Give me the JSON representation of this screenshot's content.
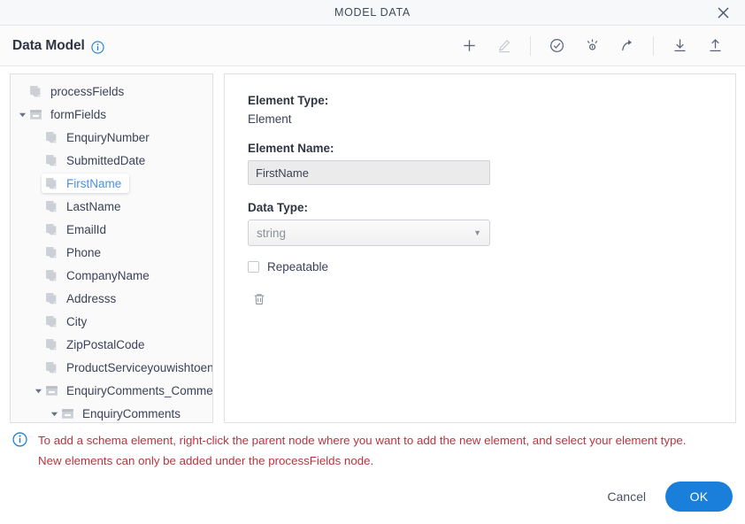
{
  "window": {
    "title": "MODEL DATA",
    "close_icon": "close-icon"
  },
  "toolbar": {
    "panel_title": "Data Model",
    "info_icon": "info-circle-icon",
    "buttons": [
      {
        "name": "add-element-button",
        "icon": "plus-icon",
        "enabled": true
      },
      {
        "name": "edit-element-button",
        "icon": "pencil-icon",
        "enabled": false
      },
      {
        "name": "validate-button",
        "icon": "check-circle-icon",
        "enabled": true
      },
      {
        "name": "generate-sample-button",
        "icon": "sparkle-icon",
        "enabled": true
      },
      {
        "name": "share-button",
        "icon": "arrow-curve-right-icon",
        "enabled": true
      },
      {
        "name": "import-button",
        "icon": "download-icon",
        "enabled": true
      },
      {
        "name": "export-button",
        "icon": "upload-icon",
        "enabled": true
      }
    ]
  },
  "tree": {
    "nodes": [
      {
        "label": "processFields",
        "depth": 0,
        "type": "leaf",
        "expandable": false,
        "expanded": false,
        "selected": false
      },
      {
        "label": "formFields",
        "depth": 0,
        "type": "folder",
        "expandable": true,
        "expanded": true,
        "selected": false
      },
      {
        "label": "EnquiryNumber",
        "depth": 1,
        "type": "leaf",
        "expandable": false,
        "expanded": false,
        "selected": false
      },
      {
        "label": "SubmittedDate",
        "depth": 1,
        "type": "leaf",
        "expandable": false,
        "expanded": false,
        "selected": false
      },
      {
        "label": "FirstName",
        "depth": 1,
        "type": "leaf",
        "expandable": false,
        "expanded": false,
        "selected": true
      },
      {
        "label": "LastName",
        "depth": 1,
        "type": "leaf",
        "expandable": false,
        "expanded": false,
        "selected": false
      },
      {
        "label": "EmailId",
        "depth": 1,
        "type": "leaf",
        "expandable": false,
        "expanded": false,
        "selected": false
      },
      {
        "label": "Phone",
        "depth": 1,
        "type": "leaf",
        "expandable": false,
        "expanded": false,
        "selected": false
      },
      {
        "label": "CompanyName",
        "depth": 1,
        "type": "leaf",
        "expandable": false,
        "expanded": false,
        "selected": false
      },
      {
        "label": "Addresss",
        "depth": 1,
        "type": "leaf",
        "expandable": false,
        "expanded": false,
        "selected": false
      },
      {
        "label": "City",
        "depth": 1,
        "type": "leaf",
        "expandable": false,
        "expanded": false,
        "selected": false
      },
      {
        "label": "ZipPostalCode",
        "depth": 1,
        "type": "leaf",
        "expandable": false,
        "expanded": false,
        "selected": false
      },
      {
        "label": "ProductServiceyouwishtoenquireabout",
        "depth": 1,
        "type": "leaf",
        "expandable": false,
        "expanded": false,
        "selected": false
      },
      {
        "label": "EnquiryComments_CommentsSection",
        "depth": 1,
        "type": "folder",
        "expandable": true,
        "expanded": true,
        "selected": false
      },
      {
        "label": "EnquiryComments",
        "depth": 2,
        "type": "folder",
        "expandable": true,
        "expanded": true,
        "selected": false
      }
    ]
  },
  "detail": {
    "element_type_label": "Element Type:",
    "element_type_value": "Element",
    "element_name_label": "Element Name:",
    "element_name_value": "FirstName",
    "data_type_label": "Data Type:",
    "data_type_value": "string",
    "data_type_options": [
      "string"
    ],
    "repeatable_label": "Repeatable",
    "repeatable_checked": false,
    "delete_icon": "trash-icon"
  },
  "message": {
    "icon": "info-circle-icon",
    "line1": "To add a schema element, right-click the parent node where you want to add the new element, and select your element type.",
    "line2": "New elements can only be added under the processFields node.",
    "color": "#b6363f"
  },
  "footer": {
    "cancel_label": "Cancel",
    "ok_label": "OK",
    "ok_color": "#1a7fdb"
  }
}
